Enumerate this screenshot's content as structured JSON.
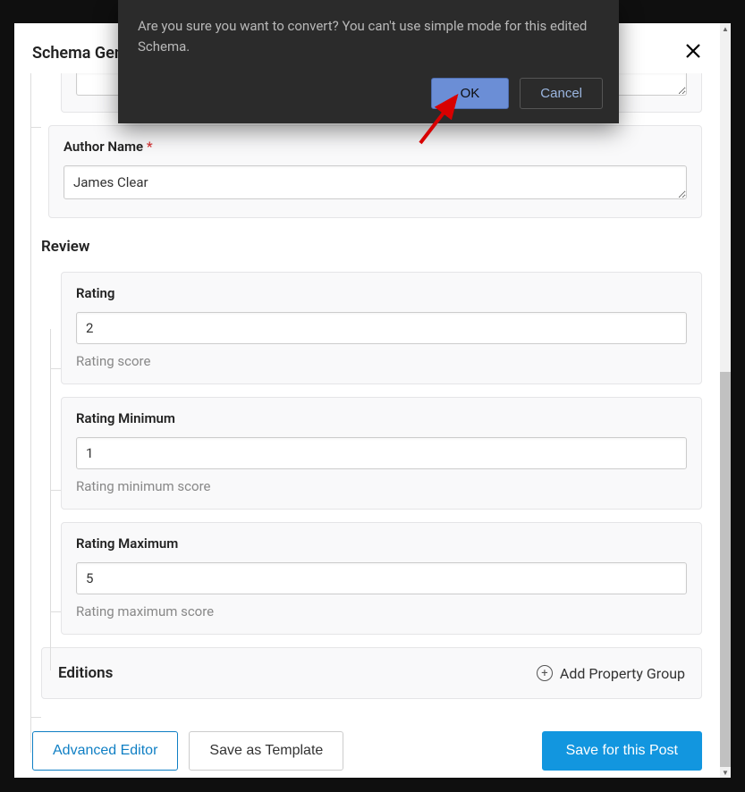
{
  "panel": {
    "title_visible": "Schema Gen",
    "close": "✕"
  },
  "confirm": {
    "text": "Are you sure you want to convert? You can't use simple mode for this edited Schema.",
    "ok": "OK",
    "cancel": "Cancel"
  },
  "author": {
    "label": "Author Name",
    "value": "James Clear"
  },
  "review": {
    "title": "Review",
    "rating": {
      "label": "Rating",
      "value": "2",
      "hint": "Rating score"
    },
    "rating_min": {
      "label": "Rating Minimum",
      "value": "1",
      "hint": "Rating minimum score"
    },
    "rating_max": {
      "label": "Rating Maximum",
      "value": "5",
      "hint": "Rating maximum score"
    }
  },
  "editions": {
    "label": "Editions",
    "add_group": "Add Property Group"
  },
  "footer": {
    "advanced": "Advanced Editor",
    "save_template": "Save as Template",
    "save_post": "Save for this Post"
  }
}
